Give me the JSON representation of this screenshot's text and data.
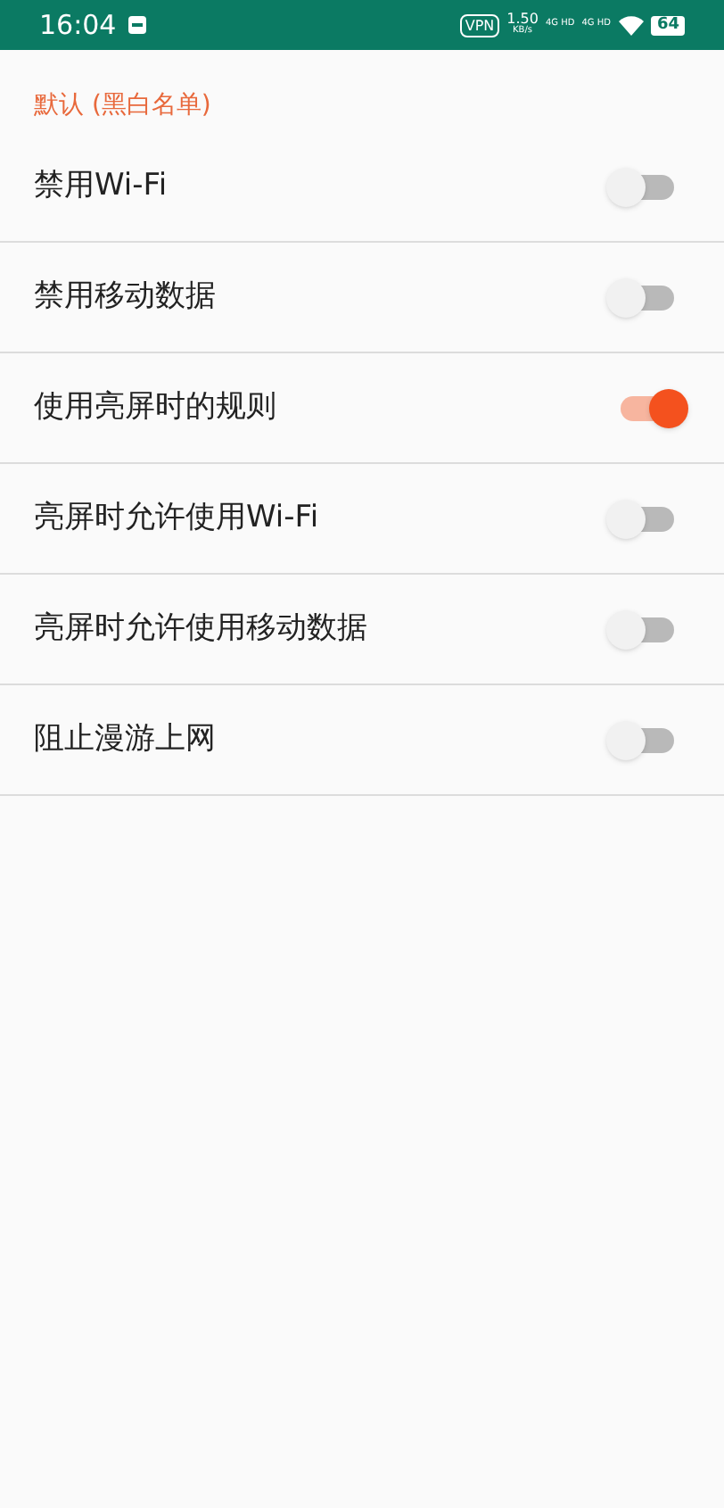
{
  "status_bar": {
    "time": "16:04",
    "vpn": "VPN",
    "speed": "1.50",
    "speed_unit": "KB/s",
    "network_1": "4G HD",
    "network_2": "4G HD",
    "battery": "64"
  },
  "section_title": "默认 (黑白名单)",
  "settings": [
    {
      "label": "禁用Wi-Fi",
      "on": false
    },
    {
      "label": "禁用移动数据",
      "on": false
    },
    {
      "label": "使用亮屏时的规则",
      "on": true
    },
    {
      "label": "亮屏时允许使用Wi-Fi",
      "on": false
    },
    {
      "label": "亮屏时允许使用移动数据",
      "on": false
    },
    {
      "label": "阻止漫游上网",
      "on": false
    }
  ]
}
